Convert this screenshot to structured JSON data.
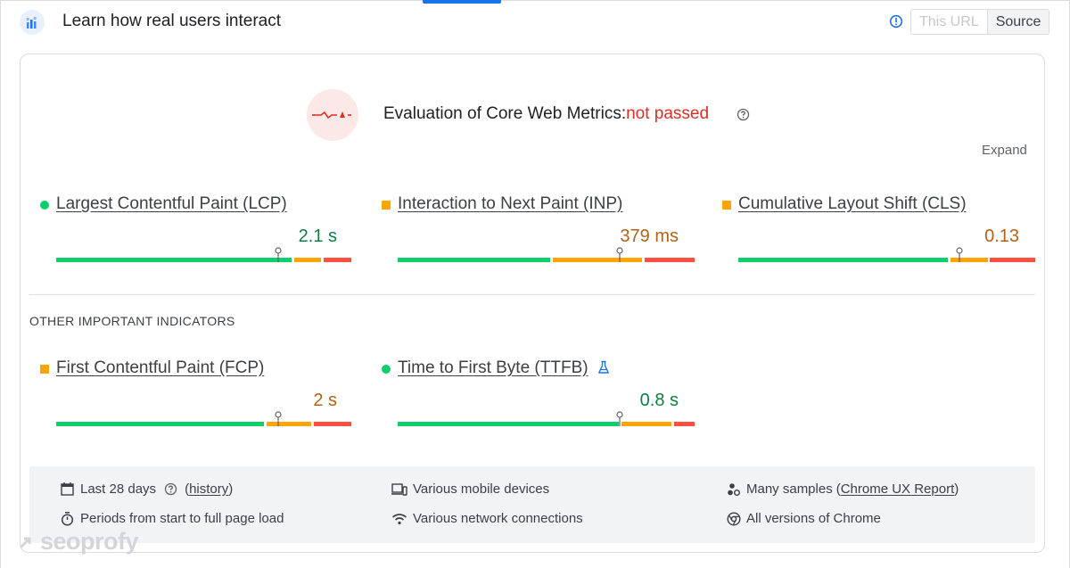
{
  "header": {
    "title": "Learn how real users interact",
    "toggle": {
      "this_url_label": "This URL",
      "source_label": "Source"
    }
  },
  "evaluation": {
    "title": "Evaluation of Core Web Metrics:",
    "status": "not passed",
    "expand_label": "Expand"
  },
  "core_metrics": [
    {
      "label": "Largest Contentful Paint (LCP)",
      "value": "2.1 s",
      "rating": "good"
    },
    {
      "label": "Interaction to Next Paint (INP)",
      "value": "379 ms",
      "rating": "needs-improvement"
    },
    {
      "label": "Cumulative Layout Shift (CLS)",
      "value": "0.13",
      "rating": "needs-improvement"
    }
  ],
  "other_section_label": "OTHER IMPORTANT INDICATORS",
  "other_metrics": [
    {
      "label": "First Contentful Paint (FCP)",
      "value": "2 s",
      "rating": "needs-improvement"
    },
    {
      "label": "Time to First Byte (TTFB)",
      "value": "0.8 s",
      "rating": "good",
      "badge_icon": "flask-icon"
    }
  ],
  "footer": {
    "period": {
      "text": "Last 28 days",
      "link": "history"
    },
    "page_load": "Periods from start to full page load",
    "devices": "Various mobile devices",
    "network": "Various network connections",
    "samples": {
      "text": "Many samples",
      "link": "Chrome UX Report"
    },
    "chrome": "All versions of Chrome"
  },
  "watermark": "seoprofy",
  "colors": {
    "good": "#0cce6b",
    "needs_improvement": "#ffa400",
    "poor": "#ff4e42",
    "failed_text": "#d93025",
    "accent": "#1a73e8"
  }
}
